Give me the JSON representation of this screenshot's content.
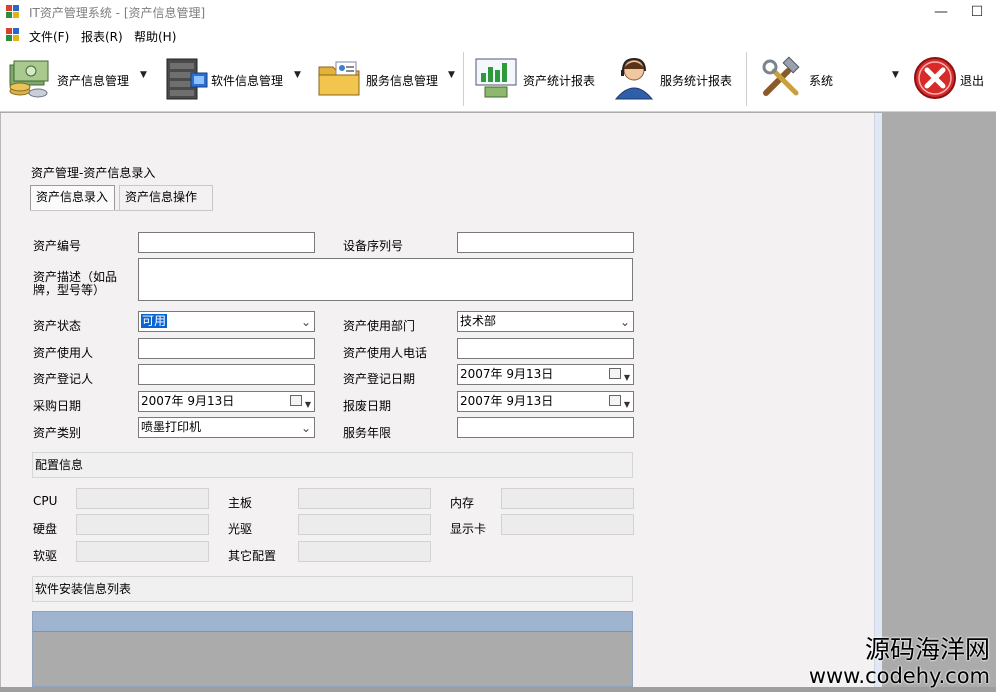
{
  "window": {
    "title": "IT资产管理系统 - [资产信息管理]",
    "minimize_glyph": "—",
    "maximize_glyph": "☐"
  },
  "menu": {
    "items": [
      "文件(F)",
      "报表(R)",
      "帮助(H)"
    ]
  },
  "toolbar": {
    "items": [
      {
        "label": "资产信息管理",
        "icon": "money-stack-icon",
        "dropdown": true
      },
      {
        "label": "软件信息管理",
        "icon": "server-rack-icon",
        "dropdown": true
      },
      {
        "label": "服务信息管理",
        "icon": "folder-id-card-icon",
        "dropdown": true
      },
      {
        "label": "资产统计报表",
        "icon": "bar-chart-board-icon",
        "dropdown": false
      },
      {
        "label": "服务统计报表",
        "icon": "support-agent-icon",
        "dropdown": false
      },
      {
        "label": "系统",
        "icon": "tools-icon",
        "dropdown": true
      },
      {
        "label": "退出",
        "icon": "exit-icon",
        "dropdown": false
      }
    ],
    "dropdown_glyph": "▼"
  },
  "page": {
    "breadcrumb": "资产管理-资产信息录入",
    "tabs": [
      {
        "label": "资产信息录入",
        "active": true
      },
      {
        "label": "资产信息操作",
        "active": false
      }
    ]
  },
  "form": {
    "asset_id": {
      "label": "资产编号",
      "value": ""
    },
    "serial_no": {
      "label": "设备序列号",
      "value": ""
    },
    "description": {
      "label": "资产描述（如品牌，型号等）",
      "value": ""
    },
    "status": {
      "label": "资产状态",
      "value": "可用"
    },
    "department": {
      "label": "资产使用部门",
      "value": "技术部"
    },
    "user": {
      "label": "资产使用人",
      "value": ""
    },
    "user_phone": {
      "label": "资产使用人电话",
      "value": ""
    },
    "registrar": {
      "label": "资产登记人",
      "value": ""
    },
    "register_date": {
      "label": "资产登记日期",
      "value": "2007年  9月13日"
    },
    "purchase_date": {
      "label": "采购日期",
      "value": "2007年  9月13日"
    },
    "scrap_date": {
      "label": "报废日期",
      "value": "2007年  9月13日"
    },
    "category": {
      "label": "资产类别",
      "value": "喷墨打印机"
    },
    "service_years": {
      "label": "服务年限",
      "value": ""
    }
  },
  "config": {
    "title": "配置信息",
    "fields": {
      "cpu": "CPU",
      "motherboard": "主板",
      "memory": "内存",
      "hdd": "硬盘",
      "optical": "光驱",
      "gpu": "显示卡",
      "floppy": "软驱",
      "other": "其它配置"
    }
  },
  "software": {
    "title": "软件安装信息列表"
  },
  "watermark": {
    "line1": "源码海洋网",
    "line2": "www.codehy.com"
  },
  "colors": {
    "accent_selection": "#0a64d2",
    "grid_header": "#9fb4cf",
    "panel_bg": "#f3f1f2"
  }
}
